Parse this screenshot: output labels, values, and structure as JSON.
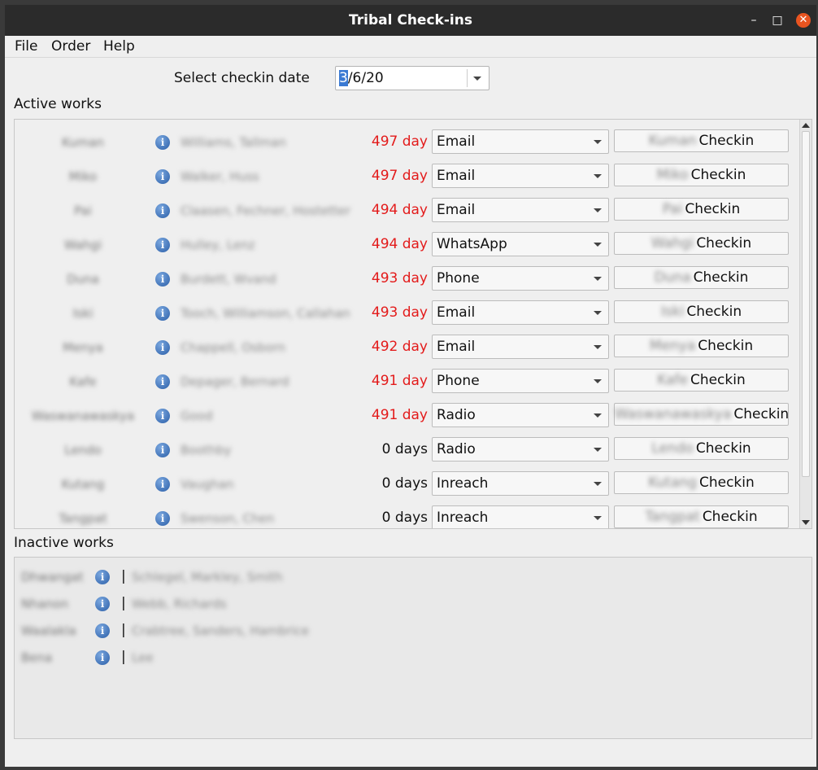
{
  "window": {
    "title": "Tribal Check-ins"
  },
  "menu": [
    "File",
    "Order",
    "Help"
  ],
  "date_selector": {
    "label": "Select checkin date",
    "value_selected": "3",
    "value_rest": "/6/20"
  },
  "active": {
    "label": "Active works",
    "rows": [
      {
        "nick": "Kuman",
        "names": "Williams, Tallman",
        "days": "497 day",
        "overdue": true,
        "method": "Email",
        "button_name": "Kuman",
        "button_suffix": "Checkin"
      },
      {
        "nick": "Miko",
        "names": "Walker, Huss",
        "days": "497 day",
        "overdue": true,
        "method": "Email",
        "button_name": "Miko",
        "button_suffix": "Checkin"
      },
      {
        "nick": "Pai",
        "names": "Claasen, Fechner, Hostetter",
        "days": "494 day",
        "overdue": true,
        "method": "Email",
        "button_name": "Pai",
        "button_suffix": "Checkin"
      },
      {
        "nick": "Wahgi",
        "names": "Hulley, Lenz",
        "days": "494 day",
        "overdue": true,
        "method": "WhatsApp",
        "button_name": "Wahgi",
        "button_suffix": "Checkin"
      },
      {
        "nick": "Duna",
        "names": "Burdett, Wvand",
        "days": "493 day",
        "overdue": true,
        "method": "Phone",
        "button_name": "Duna",
        "button_suffix": "Checkin"
      },
      {
        "nick": "Iski",
        "names": "Tooch, Williamson, Callahan",
        "days": "493 day",
        "overdue": true,
        "method": "Email",
        "button_name": "Iski",
        "button_suffix": "Checkin"
      },
      {
        "nick": "Menya",
        "names": "Chappell, Osborn",
        "days": "492 day",
        "overdue": true,
        "method": "Email",
        "button_name": "Menya",
        "button_suffix": "Checkin"
      },
      {
        "nick": "Kafe",
        "names": "Depager, Bernard",
        "days": "491 day",
        "overdue": true,
        "method": "Phone",
        "button_name": "Kafe",
        "button_suffix": "Checkin"
      },
      {
        "nick": "Waswanawaskya",
        "names": "Good",
        "days": "491 day",
        "overdue": true,
        "method": "Radio",
        "button_name": "Waswanawaskya",
        "button_suffix": "Checkin"
      },
      {
        "nick": "Lendo",
        "names": "Boothby",
        "days": "0 days",
        "overdue": false,
        "method": "Radio",
        "button_name": "Lendo",
        "button_suffix": "Checkin"
      },
      {
        "nick": "Kutang",
        "names": "Vaughan",
        "days": "0 days",
        "overdue": false,
        "method": "Inreach",
        "button_name": "Kutang",
        "button_suffix": "Checkin"
      },
      {
        "nick": "Tangpat",
        "names": "Swenson, Chen",
        "days": "0 days",
        "overdue": false,
        "method": "Inreach",
        "button_name": "Tangpat",
        "button_suffix": "Checkin"
      }
    ]
  },
  "inactive": {
    "label": "Inactive works",
    "rows": [
      {
        "nick": "Dhwangat",
        "separator": "|",
        "names": "Schlegel, Markley, Smith"
      },
      {
        "nick": "Nhanon",
        "separator": "|",
        "names": "Webb, Richards"
      },
      {
        "nick": "Waalakla",
        "separator": "|",
        "names": "Crabtree, Sanders, Hambrice"
      },
      {
        "nick": "Bena",
        "separator": "|",
        "names": "Lee"
      }
    ]
  },
  "colors": {
    "overdue": "#e31b1b",
    "titlebar": "#2b2b2b",
    "close": "#e95420",
    "info_icon": "#2b5fa8"
  }
}
